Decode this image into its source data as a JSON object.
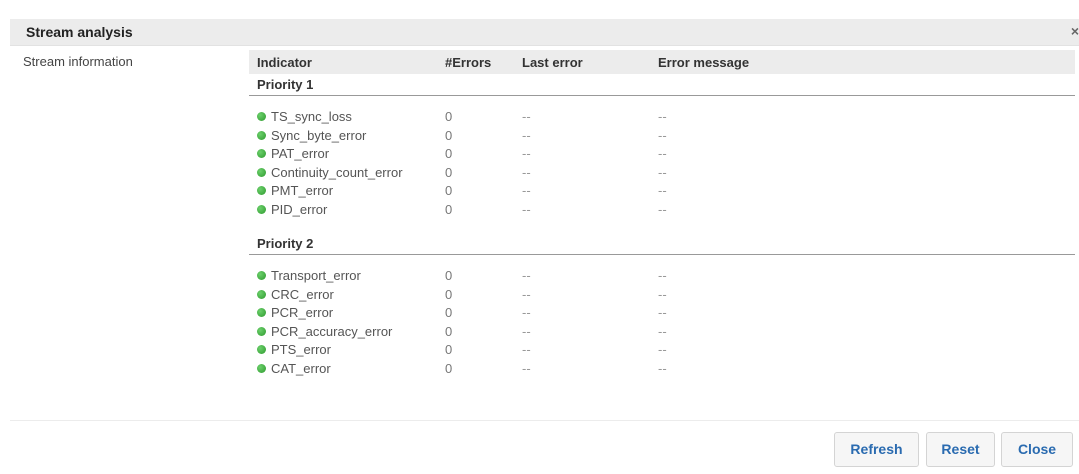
{
  "dialog": {
    "title": "Stream analysis",
    "close_glyph": "×"
  },
  "section": {
    "label": "Stream information"
  },
  "table": {
    "headers": {
      "indicator": "Indicator",
      "errors": "#Errors",
      "last_error": "Last error",
      "error_message": "Error message"
    },
    "groups": [
      {
        "title": "Priority 1",
        "rows": [
          {
            "indicator": "TS_sync_loss",
            "errors": "0",
            "last_error": "--",
            "error_message": "--",
            "status": "ok"
          },
          {
            "indicator": "Sync_byte_error",
            "errors": "0",
            "last_error": "--",
            "error_message": "--",
            "status": "ok"
          },
          {
            "indicator": "PAT_error",
            "errors": "0",
            "last_error": "--",
            "error_message": "--",
            "status": "ok"
          },
          {
            "indicator": "Continuity_count_error",
            "errors": "0",
            "last_error": "--",
            "error_message": "--",
            "status": "ok"
          },
          {
            "indicator": "PMT_error",
            "errors": "0",
            "last_error": "--",
            "error_message": "--",
            "status": "ok"
          },
          {
            "indicator": "PID_error",
            "errors": "0",
            "last_error": "--",
            "error_message": "--",
            "status": "ok"
          }
        ]
      },
      {
        "title": "Priority 2",
        "rows": [
          {
            "indicator": "Transport_error",
            "errors": "0",
            "last_error": "--",
            "error_message": "--",
            "status": "ok"
          },
          {
            "indicator": "CRC_error",
            "errors": "0",
            "last_error": "--",
            "error_message": "--",
            "status": "ok"
          },
          {
            "indicator": "PCR_error",
            "errors": "0",
            "last_error": "--",
            "error_message": "--",
            "status": "ok"
          },
          {
            "indicator": "PCR_accuracy_error",
            "errors": "0",
            "last_error": "--",
            "error_message": "--",
            "status": "ok"
          },
          {
            "indicator": "PTS_error",
            "errors": "0",
            "last_error": "--",
            "error_message": "--",
            "status": "ok"
          },
          {
            "indicator": "CAT_error",
            "errors": "0",
            "last_error": "--",
            "error_message": "--",
            "status": "ok"
          }
        ]
      }
    ]
  },
  "buttons": {
    "refresh": "Refresh",
    "reset": "Reset",
    "close": "Close"
  },
  "colors": {
    "status_ok": "#3aa83a",
    "button_text": "#2a6bb0",
    "header_bg": "#ececec"
  }
}
